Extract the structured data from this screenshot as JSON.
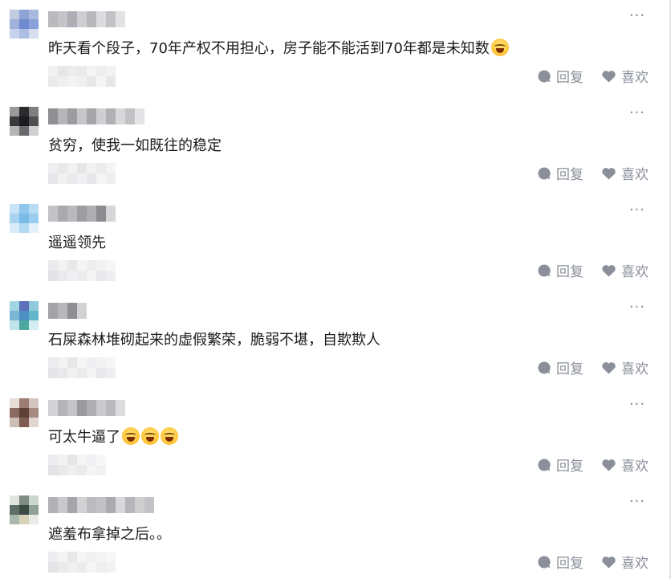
{
  "comments": [
    {
      "text": "昨天看个段子，70年产权不用担心，房子能不能活到70年都是未知数",
      "emoji_count": 1,
      "more_label": "···",
      "reply_label": "回复",
      "like_label": "喜欢"
    },
    {
      "text": "贫穷，使我一如既往的稳定",
      "emoji_count": 0,
      "more_label": "···",
      "reply_label": "回复",
      "like_label": "喜欢"
    },
    {
      "text": "遥遥领先",
      "emoji_count": 0,
      "more_label": "···",
      "reply_label": "回复",
      "like_label": "喜欢"
    },
    {
      "text": "石屎森林堆砌起来的虚假繁荣，脆弱不堪，自欺欺人",
      "emoji_count": 0,
      "more_label": "···",
      "reply_label": "回复",
      "like_label": "喜欢"
    },
    {
      "text": "可太牛逼了",
      "emoji_count": 3,
      "more_label": "···",
      "reply_label": "回复",
      "like_label": "喜欢"
    },
    {
      "text": "遮羞布拿掉之后。。",
      "emoji_count": 0,
      "more_label": "···",
      "reply_label": "回复",
      "like_label": "喜欢"
    }
  ],
  "icons": {
    "reply": "comment-bubble-icon",
    "like": "heart-icon",
    "more": "more-dots-icon",
    "emoji": "rolling-laugh-emoji-icon"
  },
  "colors": {
    "action": "#8a8f99",
    "text": "#1b1b1b",
    "more": "#8a8a8a"
  }
}
